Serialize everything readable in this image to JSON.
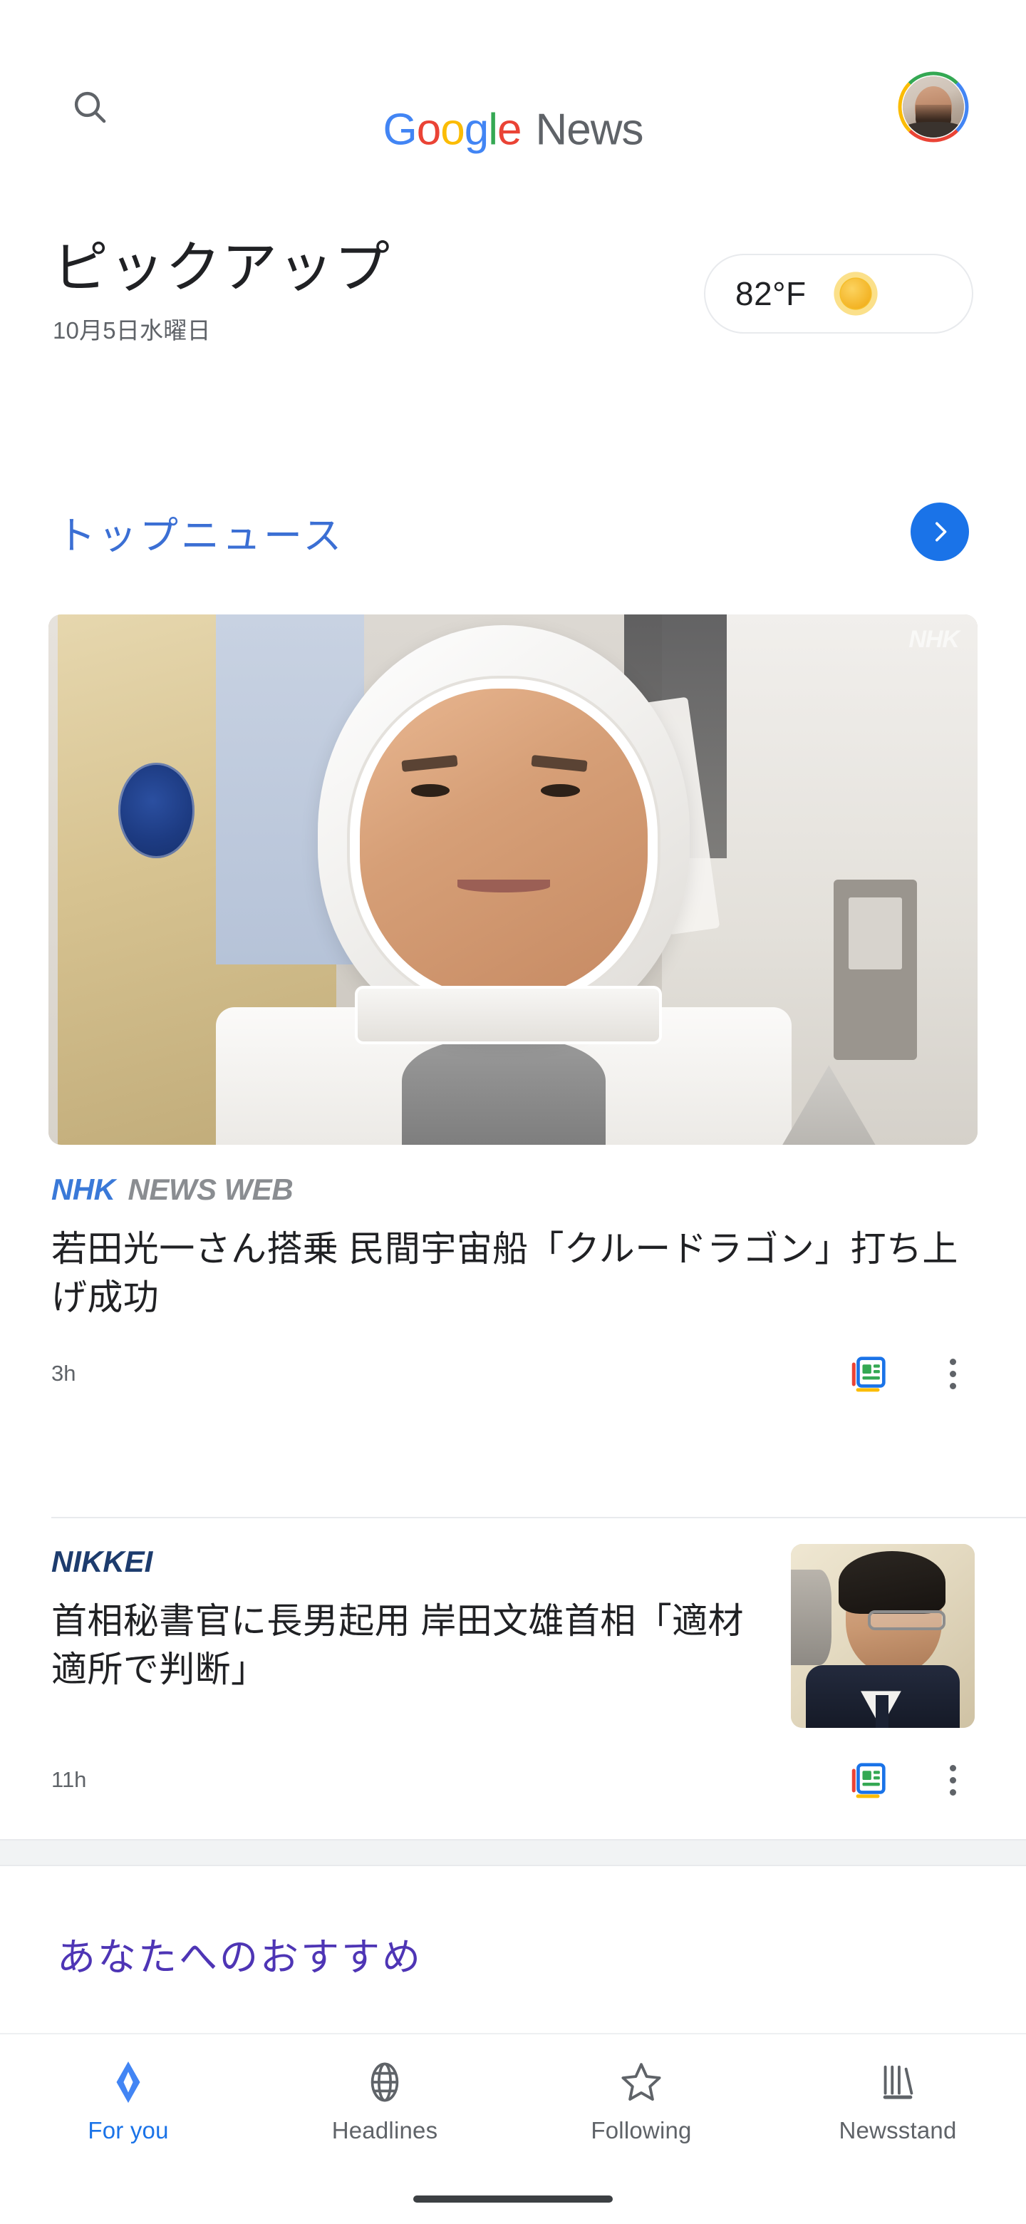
{
  "appbar": {
    "search_icon": "search-icon",
    "brand": {
      "g1": "G",
      "o1": "o",
      "o2": "o",
      "g2": "g",
      "l1": "l",
      "e1": "e",
      "news": "News"
    },
    "avatar": "user-avatar"
  },
  "header": {
    "page_title": "ピックアップ",
    "date": "10月5日水曜日",
    "weather": {
      "temperature": "82°F",
      "icon": "sun-icon"
    }
  },
  "sections": {
    "top_news": {
      "title": "トップニュース",
      "more_icon": "chevron-right-icon"
    },
    "recommended": {
      "title": "あなたへのおすすめ"
    }
  },
  "articles": [
    {
      "source_parts": {
        "primary": "NHK",
        "secondary": "NEWS WEB"
      },
      "source_name": "NHK NEWS WEB",
      "headline": "若田光一さん搭乗 民間宇宙船「クルードラゴン」打ち上げ成功",
      "time": "3h",
      "image_watermark": "NHK",
      "coverage_icon": "full-coverage-icon",
      "menu_icon": "more-options-icon",
      "has_hero_image": true
    },
    {
      "source_parts": {
        "primary": "NIKKEI",
        "secondary": ""
      },
      "source_name": "NIKKEI",
      "headline": "首相秘書官に長男起用 岸田文雄首相「適材適所で判断」",
      "time": "11h",
      "coverage_icon": "full-coverage-icon",
      "menu_icon": "more-options-icon",
      "has_thumbnail": true
    }
  ],
  "bottom_nav": {
    "items": [
      {
        "label": "For you",
        "icon": "sparkle-diamond-icon",
        "active": true
      },
      {
        "label": "Headlines",
        "icon": "globe-icon",
        "active": false
      },
      {
        "label": "Following",
        "icon": "star-icon",
        "active": false
      },
      {
        "label": "Newsstand",
        "icon": "newsstand-icon",
        "active": false
      }
    ]
  },
  "colors": {
    "google_blue": "#4285F4",
    "google_red": "#EA4335",
    "google_yellow": "#FBBC05",
    "google_green": "#34A853",
    "accent_blue": "#1a73e8",
    "section_blue": "#3b6fd4",
    "section_purple": "#4e35b5",
    "text_primary": "#202124",
    "text_secondary": "#5F6368",
    "divider": "#E8EAED",
    "nikkei_navy": "#1d3c6e"
  }
}
